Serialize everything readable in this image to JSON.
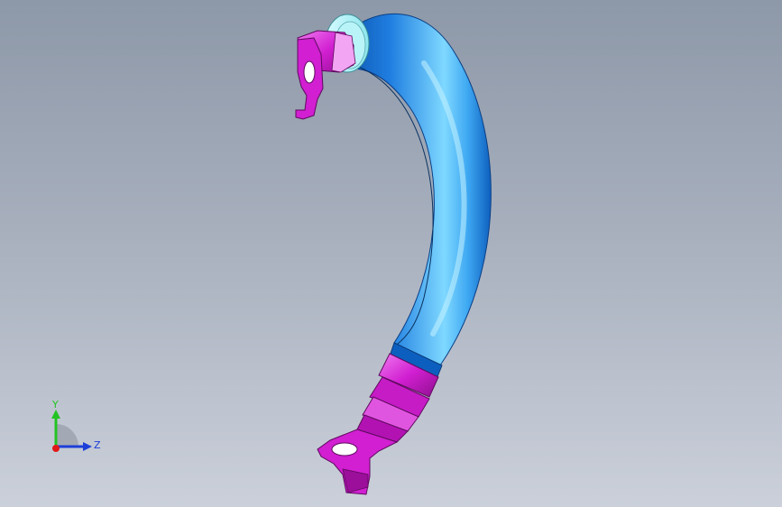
{
  "viewport": {
    "background_top": "#8d98a8",
    "background_bottom": "#cbd0da"
  },
  "model": {
    "hose_color": "#1f8ee8",
    "fitting_color": "#d21ed2",
    "collar_color": "#a8f0f4"
  },
  "triad": {
    "y_label": "Y",
    "z_label": "Z",
    "y_color": "#22c322",
    "z_color": "#1d3fd8",
    "x_color": "#e01818"
  }
}
